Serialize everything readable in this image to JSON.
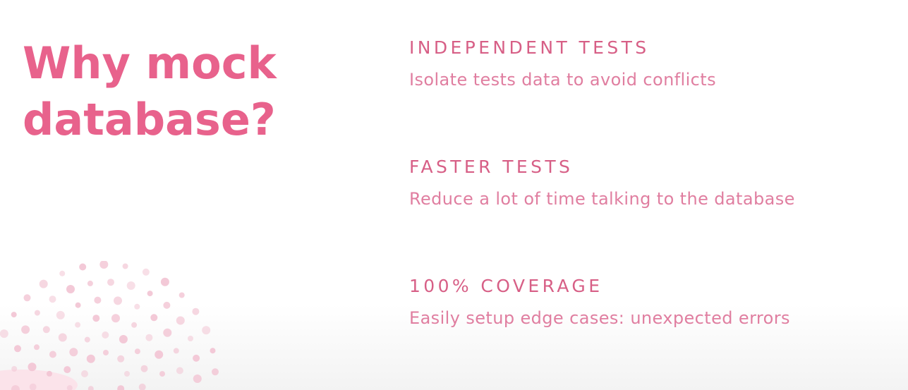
{
  "slide": {
    "title_line1": "Why mock",
    "title_line2": "database?",
    "points": [
      {
        "heading": "INDEPENDENT TESTS",
        "description": "Isolate tests data to avoid conflicts"
      },
      {
        "heading": "FASTER TESTS",
        "description": "Reduce a lot of time talking to the database"
      },
      {
        "heading": "100% COVERAGE",
        "description": "Easily setup edge cases: unexpected errors"
      }
    ]
  },
  "colors": {
    "accent": "#e8628c",
    "heading": "#d75f86",
    "body_text": "#e07ea0",
    "dots": "#f2c4d3",
    "background": "#ffffff"
  },
  "icons": {
    "decoration": "dotted-circle-pattern"
  }
}
